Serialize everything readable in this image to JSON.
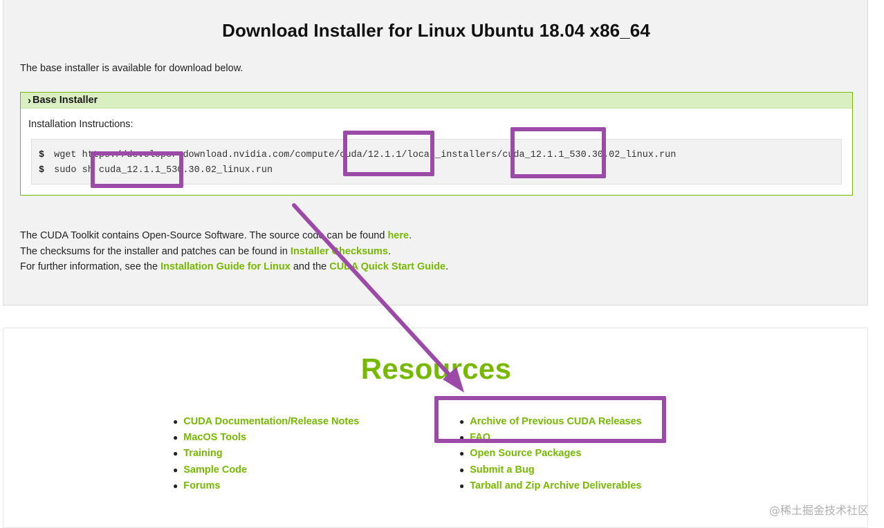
{
  "download": {
    "title": "Download Installer for Linux Ubuntu 18.04 x86_64",
    "intro": "The base installer is available for download below.",
    "installer": {
      "header_label": "Base Installer",
      "instructions_label": "Installation Instructions:",
      "prompt": "$",
      "command_1": "wget https://developer.download.nvidia.com/compute/cuda/12.1.1/local_installers/cuda_12.1.1_530.30.02_linux.run",
      "command_2": "sudo sh cuda_12.1.1_530.30.02_linux.run"
    },
    "info": {
      "line1_prefix": "The CUDA Toolkit contains Open-Source Software. The source code can be found ",
      "line1_link": "here",
      "line1_suffix": ".",
      "line2_prefix": "The checksums for the installer and patches can be found in ",
      "line2_link": "Installer Checksums",
      "line2_suffix": ".",
      "line3_prefix": "For further information, see the ",
      "line3_link1": "Installation Guide for Linux",
      "line3_mid": " and the ",
      "line3_link2": "CUDA Quick Start Guide",
      "line3_suffix": "."
    }
  },
  "resources": {
    "title": "Resources",
    "left_links": [
      "CUDA Documentation/Release Notes",
      "MacOS Tools",
      "Training",
      "Sample Code",
      "Forums"
    ],
    "right_links": [
      "Archive of Previous CUDA Releases",
      "FAQ",
      "Open Source Packages",
      "Submit a Bug",
      "Tarball and Zip Archive Deliverables"
    ]
  },
  "watermark": "@稀土掘金技术社区",
  "colors": {
    "accent_green": "#76b900",
    "annotation_purple": "#9b4aa8",
    "header_green": "#d9efc2"
  },
  "icons": {
    "section_toggle": "chevron-right-icon"
  }
}
